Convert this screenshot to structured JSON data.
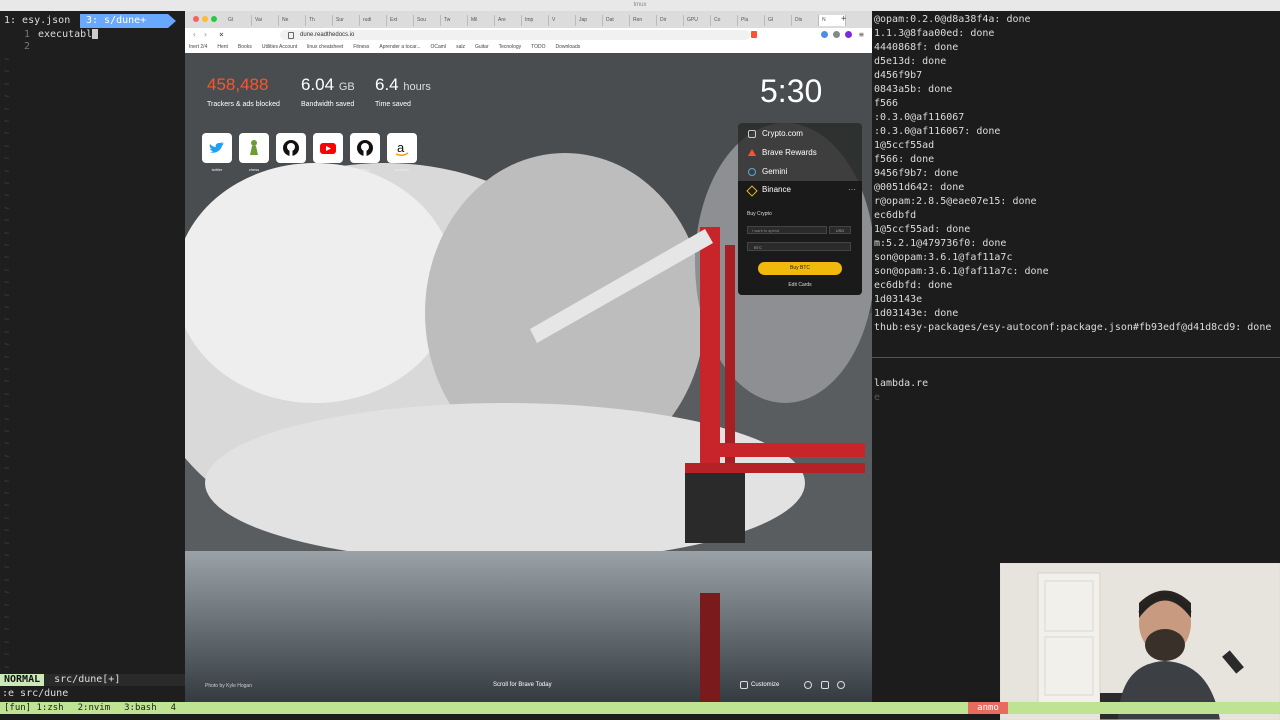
{
  "mac_title": "tmux",
  "vim": {
    "tabs": {
      "first": "1: esy.json",
      "second": "3: s/dune+"
    },
    "lines": [
      {
        "num": "1",
        "text": "executabl"
      },
      {
        "num": "2",
        "text": ""
      }
    ],
    "mode": "NORMAL",
    "file": "src/dune[+]",
    "cmdline": ":e src/dune"
  },
  "tmux": {
    "windows": [
      "[fun] 1:zsh",
      "2:nvim",
      "3:bash",
      "4"
    ],
    "right": "anmo"
  },
  "terminal": {
    "lines": [
      "@opam:0.2.0@d8a38f4a: done",
      "1.1.3@8faa00ed: done",
      "4440868f: done",
      "d5e13d: done",
      "d456f9b7",
      "0843a5b: done",
      "f566",
      ":0.3.0@af116067",
      ":0.3.0@af116067: done",
      "1@5ccf55ad",
      "f566: done",
      "9456f9b7: done",
      "@0051d642: done",
      "r@opam:2.8.5@eae07e15: done",
      "ec6dbfd",
      "1@5ccf55ad: done",
      "m:5.2.1@479736f0: done",
      "son@opam:3.6.1@faf11a7c",
      "son@opam:3.6.1@faf11a7c: done",
      "ec6dbfd: done",
      "1d03143e",
      "1d03143e: done",
      "thub:esy-packages/esy-autoconf:package.json#fb93edf@d41d8cd9: done"
    ],
    "lower_lines": [
      "lambda.re",
      "e"
    ]
  },
  "browser": {
    "tabs": [
      "GI",
      "Vai",
      "Ne",
      "Th",
      "Sur",
      "rudi",
      "Ext",
      "Sou",
      "Tw",
      "Mil",
      "Are",
      "Imp",
      "V",
      "Jap",
      "Dat",
      "Ren",
      "Dir",
      "GPU",
      "Co",
      "Pla",
      "GI",
      "Dis",
      "N"
    ],
    "url": "dune.readthedocs.io",
    "bookmarks": [
      "Inert 2/4",
      "Hent",
      "Books",
      "Utilities Account",
      "linux cheatsheet",
      "Fitness",
      "Aprender a tocar...",
      "OCaml",
      "salz",
      "Guitar",
      "Tecnology",
      "TODO",
      "Downloads"
    ]
  },
  "ntp": {
    "stats": [
      {
        "value": "458,488",
        "unit": "",
        "label": "Trackers & ads blocked",
        "color": "#fb542b"
      },
      {
        "value": "6.04",
        "unit": "GB",
        "label": "Bandwidth saved",
        "color": "#ffffff"
      },
      {
        "value": "6.4",
        "unit": "hours",
        "label": "Time saved",
        "color": "#ffffff"
      }
    ],
    "clock": "5:30",
    "tiles": [
      {
        "icon": "twitter-icon",
        "label": "twitter",
        "color": "#1da1f2"
      },
      {
        "icon": "chess-icon",
        "label": "chess",
        "color": "#6b9b3a"
      },
      {
        "icon": "github-icon",
        "label": "github",
        "color": "#111111"
      },
      {
        "icon": "youtube-icon",
        "label": "youtube",
        "color": "#ff0000"
      },
      {
        "icon": "github-icon",
        "label": "github",
        "color": "#111111"
      },
      {
        "icon": "amazon-icon",
        "label": "amazon",
        "color": "#111111"
      }
    ],
    "widgets": {
      "items": [
        "Crypto.com",
        "Brave Rewards",
        "Gemini",
        "Binance"
      ],
      "buy_crypto": "Buy Crypto",
      "input_placeholder": "I want to spend",
      "currency": "USD",
      "asset": "BTC",
      "buy_button": "Buy BTC",
      "edit_cards": "Edit Cards"
    },
    "photo_credit": "Photo by Kyle Hogan",
    "scroll_hint": "Scroll for Brave Today",
    "customize": "Customize"
  }
}
